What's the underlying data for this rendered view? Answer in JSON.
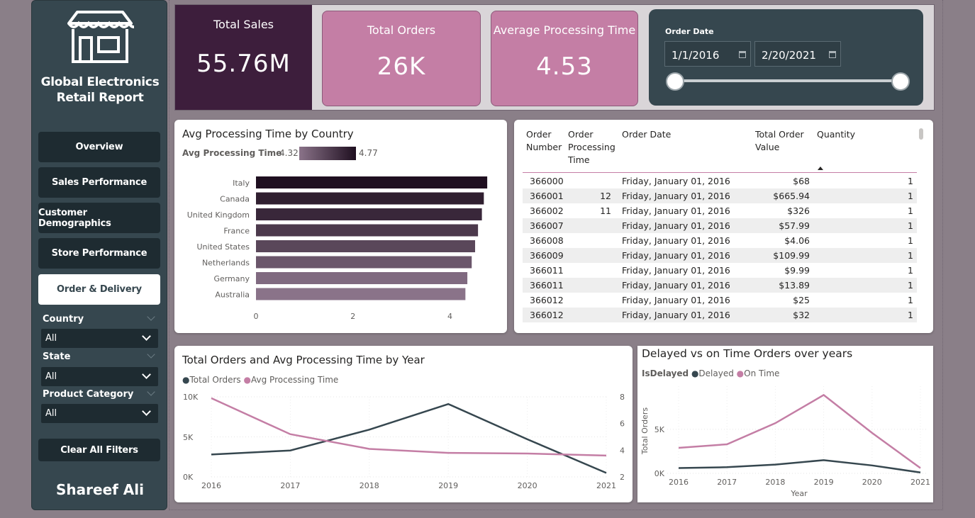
{
  "sidebar": {
    "brand_line1": "Global Electronics",
    "brand_line2": "Retail Report",
    "nav": [
      {
        "label": "Overview"
      },
      {
        "label": "Sales Performance"
      },
      {
        "label": "Customer Demographics"
      },
      {
        "label": "Store Performance"
      },
      {
        "label": "Order & Delivery",
        "active": true
      }
    ],
    "filters": [
      {
        "label": "Country",
        "value": "All"
      },
      {
        "label": "State",
        "value": "All"
      },
      {
        "label": "Product Category",
        "value": "All"
      }
    ],
    "clear_label": "Clear All Filters",
    "author": "Shareef Ali"
  },
  "kpis": {
    "total_sales": {
      "title": "Total Sales",
      "value": "55.76M"
    },
    "total_orders": {
      "title": "Total Orders",
      "value": "26K"
    },
    "avg_processing": {
      "title": "Average Processing Time",
      "value": "4.53"
    }
  },
  "date_filter": {
    "label": "Order Date",
    "start": "1/1/2016",
    "end": "2/20/2021"
  },
  "country_chart": {
    "title": "Avg Processing Time by Country",
    "legend_label": "Avg Processing Time",
    "legend_min": "4.32",
    "legend_max": "4.77",
    "x_ticks": [
      "0",
      "2",
      "4"
    ]
  },
  "table": {
    "headers": {
      "order_number": [
        "Order",
        "Number"
      ],
      "processing": [
        "Order",
        "Processing",
        "Time"
      ],
      "date": [
        "Order Date"
      ],
      "value": [
        "Total Order",
        "Value"
      ],
      "qty": [
        "Quantity"
      ]
    },
    "rows": [
      {
        "num": "366000",
        "proc": "",
        "date": "Friday, January 01, 2016",
        "value": "$68",
        "qty": "1"
      },
      {
        "num": "366001",
        "proc": "12",
        "date": "Friday, January 01, 2016",
        "value": "$665.94",
        "qty": "1"
      },
      {
        "num": "366002",
        "proc": "11",
        "date": "Friday, January 01, 2016",
        "value": "$326",
        "qty": "1"
      },
      {
        "num": "366007",
        "proc": "",
        "date": "Friday, January 01, 2016",
        "value": "$57.99",
        "qty": "1"
      },
      {
        "num": "366008",
        "proc": "",
        "date": "Friday, January 01, 2016",
        "value": "$4.06",
        "qty": "1"
      },
      {
        "num": "366009",
        "proc": "",
        "date": "Friday, January 01, 2016",
        "value": "$109.99",
        "qty": "1"
      },
      {
        "num": "366011",
        "proc": "",
        "date": "Friday, January 01, 2016",
        "value": "$9.99",
        "qty": "1"
      },
      {
        "num": "366011",
        "proc": "",
        "date": "Friday, January 01, 2016",
        "value": "$13.89",
        "qty": "1"
      },
      {
        "num": "366012",
        "proc": "",
        "date": "Friday, January 01, 2016",
        "value": "$25",
        "qty": "1"
      },
      {
        "num": "366012",
        "proc": "",
        "date": "Friday, January 01, 2016",
        "value": "$32",
        "qty": "1"
      }
    ]
  },
  "year_chart": {
    "title": "Total Orders and Avg Processing Time by Year",
    "legend1": "Total Orders",
    "legend2": "Avg Processing Time",
    "y_left_ticks": [
      "10K",
      "5K",
      "0K"
    ],
    "y_right_ticks": [
      "8",
      "6",
      "4",
      "2"
    ],
    "x_ticks": [
      "2016",
      "2017",
      "2018",
      "2019",
      "2020",
      "2021"
    ]
  },
  "delay_chart": {
    "title": "Delayed vs on Time Orders over years",
    "legend_title": "IsDelayed",
    "legend1": "Delayed",
    "legend2": "On Time",
    "y_label": "Total Orders",
    "x_label": "Year",
    "y_ticks": [
      "5K",
      "0K"
    ],
    "x_ticks": [
      "2016",
      "2017",
      "2018",
      "2019",
      "2020",
      "2021"
    ]
  },
  "colors": {
    "sidebar": "#36474f",
    "dark_plum": "#3d1e3c",
    "pink": "#c47ea5",
    "slate_line": "#36474f"
  },
  "chart_data": [
    {
      "type": "bar",
      "title": "Avg Processing Time by Country",
      "orientation": "horizontal",
      "categories": [
        "Italy",
        "Canada",
        "United Kingdom",
        "France",
        "United States",
        "Netherlands",
        "Germany",
        "Australia"
      ],
      "values": [
        4.77,
        4.7,
        4.66,
        4.58,
        4.52,
        4.45,
        4.36,
        4.32
      ],
      "xlim": [
        0,
        4.9
      ]
    },
    {
      "type": "line",
      "title": "Total Orders and Avg Processing Time by Year",
      "x": [
        "2016",
        "2017",
        "2018",
        "2019",
        "2020",
        "2021"
      ],
      "series": [
        {
          "name": "Total Orders",
          "axis": "left",
          "values": [
            2800,
            3300,
            5900,
            9100,
            4700,
            500
          ],
          "color": "#36474f"
        },
        {
          "name": "Avg Processing Time",
          "axis": "right",
          "values": [
            7.9,
            5.2,
            4.1,
            3.8,
            3.75,
            3.6
          ],
          "color": "#c47ea5"
        }
      ],
      "ylim_left": [
        0,
        10000
      ],
      "ylim_right": [
        2,
        8
      ]
    },
    {
      "type": "line",
      "title": "Delayed vs on Time Orders over years",
      "x": [
        "2016",
        "2017",
        "2018",
        "2019",
        "2020",
        "2021"
      ],
      "series": [
        {
          "name": "Delayed",
          "values": [
            600,
            700,
            1000,
            1500,
            900,
            100
          ],
          "color": "#36474f"
        },
        {
          "name": "On Time",
          "values": [
            2900,
            3300,
            5700,
            8900,
            4600,
            600
          ],
          "color": "#c47ea5"
        }
      ],
      "ylim": [
        0,
        9900
      ]
    }
  ]
}
